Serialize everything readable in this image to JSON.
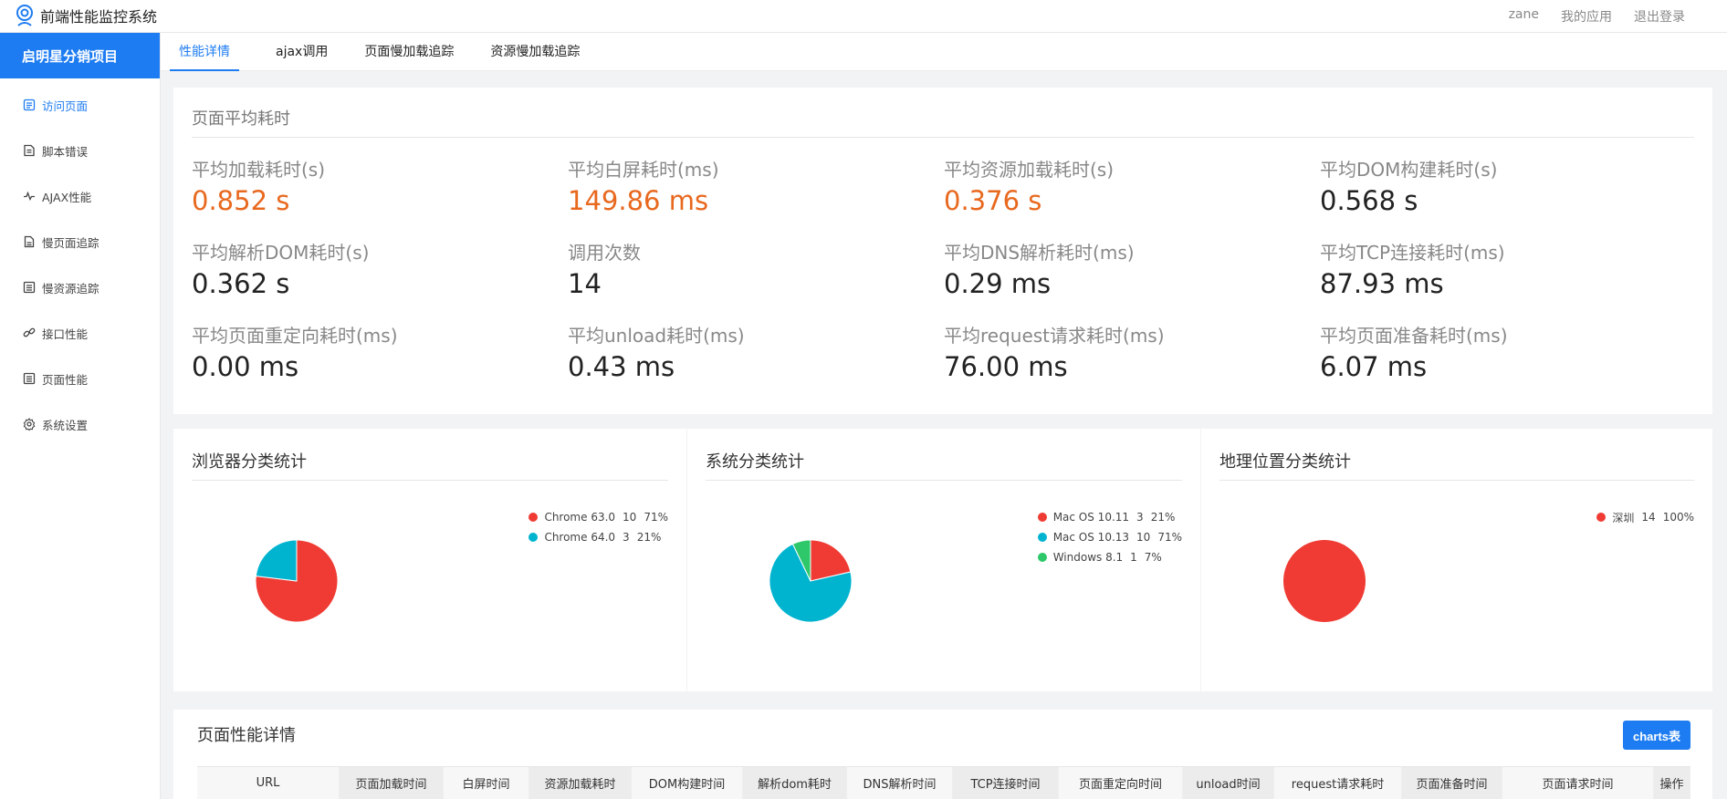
{
  "app": {
    "title": "前端性能监控系统"
  },
  "top_links": [
    "zane",
    "我的应用",
    "退出登录"
  ],
  "project": "启明星分销项目",
  "menu": [
    {
      "label": "访问页面",
      "icon": "document-icon",
      "active": true
    },
    {
      "label": "脚本错误",
      "icon": "script-error-icon",
      "active": false
    },
    {
      "label": "AJAX性能",
      "icon": "pulse-icon",
      "active": false
    },
    {
      "label": "慢页面追踪",
      "icon": "page-icon",
      "active": false
    },
    {
      "label": "慢资源追踪",
      "icon": "list-icon",
      "active": false
    },
    {
      "label": "接口性能",
      "icon": "link-icon",
      "active": false
    },
    {
      "label": "页面性能",
      "icon": "document-icon",
      "active": false
    },
    {
      "label": "系统设置",
      "icon": "gear-icon",
      "active": false
    }
  ],
  "tabs": [
    {
      "label": "性能详情",
      "active": true
    },
    {
      "label": "ajax调用",
      "active": false
    },
    {
      "label": "页面慢加载追踪",
      "active": false
    },
    {
      "label": "资源慢加载追踪",
      "active": false
    }
  ],
  "stats": {
    "title": "页面平均耗时",
    "items": [
      {
        "label": "平均加载耗时(s)",
        "value": "0.852 s",
        "highlight": true
      },
      {
        "label": "平均白屏耗时(ms)",
        "value": "149.86 ms",
        "highlight": true
      },
      {
        "label": "平均资源加载耗时(s)",
        "value": "0.376 s",
        "highlight": true
      },
      {
        "label": "平均DOM构建耗时(s)",
        "value": "0.568 s",
        "highlight": false
      },
      {
        "label": "平均解析DOM耗时(s)",
        "value": "0.362 s",
        "highlight": false
      },
      {
        "label": "调用次数",
        "value": "14",
        "highlight": false
      },
      {
        "label": "平均DNS解析耗时(ms)",
        "value": "0.29 ms",
        "highlight": false
      },
      {
        "label": "平均TCP连接耗时(ms)",
        "value": "87.93 ms",
        "highlight": false
      },
      {
        "label": "平均页面重定向耗时(ms)",
        "value": "0.00 ms",
        "highlight": false
      },
      {
        "label": "平均unload耗时(ms)",
        "value": "0.43 ms",
        "highlight": false
      },
      {
        "label": "平均request请求耗时(ms)",
        "value": "76.00 ms",
        "highlight": false
      },
      {
        "label": "平均页面准备耗时(ms)",
        "value": "6.07 ms",
        "highlight": false
      }
    ]
  },
  "chart_data": [
    {
      "type": "pie",
      "title": "浏览器分类统计",
      "slices": [
        {
          "name": "Chrome 63.0",
          "count": "10",
          "percent": "71%",
          "value": 10,
          "color": "#ef3b33"
        },
        {
          "name": "Chrome 64.0",
          "count": "3",
          "percent": "21%",
          "value": 3,
          "color": "#00b4d0"
        }
      ]
    },
    {
      "type": "pie",
      "title": "系统分类统计",
      "slices": [
        {
          "name": "Mac OS 10.11",
          "count": "3",
          "percent": "21%",
          "value": 3,
          "color": "#ef3b33"
        },
        {
          "name": "Mac OS 10.13",
          "count": "10",
          "percent": "71%",
          "value": 10,
          "color": "#00b4d0"
        },
        {
          "name": "Windows 8.1",
          "count": "1",
          "percent": "7%",
          "value": 1,
          "color": "#2ec86b"
        }
      ]
    },
    {
      "type": "pie",
      "title": "地理位置分类统计",
      "slices": [
        {
          "name": "深圳",
          "count": "14",
          "percent": "100%",
          "value": 14,
          "color": "#ef3b33"
        }
      ]
    }
  ],
  "detail": {
    "title": "页面性能详情",
    "button": "charts表",
    "columns": [
      "URL",
      "页面加载时间",
      "白屏时间",
      "资源加载耗时",
      "DOM构建时间",
      "解析dom耗时",
      "DNS解析时间",
      "TCP连接时间",
      "页面重定向时间",
      "unload时间",
      "request请求耗时",
      "页面准备时间",
      "页面请求时间",
      "操作"
    ]
  }
}
